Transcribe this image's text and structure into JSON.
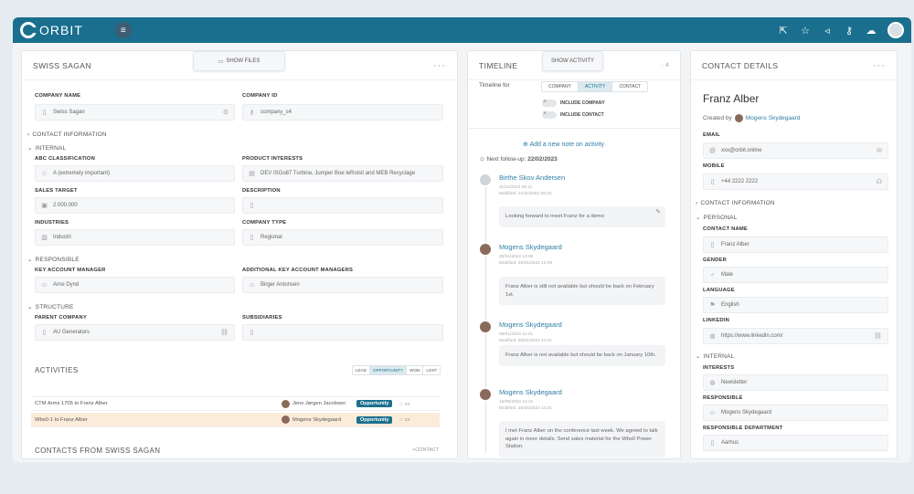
{
  "brand": {
    "name": "ORBIT"
  },
  "colors": {
    "accent": "#1a6f8e",
    "link": "#2f7fa6",
    "highlight_row": "#fbecd9"
  },
  "topbar_icons": [
    "share-icon",
    "star-icon",
    "megaphone-icon",
    "key-icon",
    "cloud-icon",
    "user-avatar"
  ],
  "company": {
    "title": "SWISS SAGAN",
    "show_files": "SHOW FILES",
    "company_name_label": "COMPANY NAME",
    "company_name": "Swiss Sagan",
    "company_id_label": "COMPANY ID",
    "company_id": "company_s4",
    "contact_info_section": "CONTACT INFORMATION",
    "internal_section": "INTERNAL",
    "abc_label": "ABC CLASSIFICATION",
    "abc_value": "A (extremely important)",
    "product_interests_label": "PRODUCT INTERESTS",
    "product_interests_value": "DEV ISGo87 Turbine, Jumper Boe leRoisit and MEB Recyclage",
    "sales_target_label": "SALES TARGET",
    "sales_target_value": "2.000.000",
    "description_label": "DESCRIPTION",
    "industries_label": "INDUSTRIES",
    "industries_value": "Industri",
    "company_type_label": "COMPANY TYPE",
    "company_type_value": "Regional",
    "responsible_section": "RESPONSIBLE",
    "kam_label": "KEY ACCOUNT MANAGER",
    "kam_value": "Arne Dynd",
    "akam_label": "ADDITIONAL KEY ACCOUNT MANAGERS",
    "akam_value": "Birger Antonsen",
    "structure_section": "STRUCTURE",
    "parent_label": "PARENT COMPANY",
    "parent_value": "AU Generators",
    "subsidiaries_label": "SUBSIDIARIES",
    "activities_title": "ACTIVITIES",
    "activity_filters": [
      "LEAD",
      "OPPORTUNITY",
      "WON",
      "LOST"
    ],
    "activities": [
      {
        "title": "CTM Arms 1705 to Franz Alber",
        "person": "Jens Jørgen Jacobsen",
        "status": "Opportunity"
      },
      {
        "title": "Wbs0-1 to Franz Alber",
        "person": "Mogens Skydegaard",
        "status": "Opportunity"
      }
    ],
    "contacts_title": "CONTACTS FROM SWISS SAGAN",
    "contacts_action": "+CONTACT"
  },
  "timeline": {
    "title": "TIMELINE",
    "show_activity": "SHOW ACTIVITY",
    "count": "4",
    "timeline_for": "Timeline for",
    "tabs": [
      "COMPANY",
      "ACTIVITY",
      "CONTACT"
    ],
    "include_company": "INCLUDE COMPANY",
    "include_contact": "INCLUDE CONTACT",
    "add_note": "Add a new note on activity",
    "next_followup_label": "Next follow-up:",
    "next_followup_date": "22/02/2023",
    "entries": [
      {
        "name": "Birthe Skov Andersen",
        "created": "11/11/2022 09:11",
        "modified": "Modified: 11/11/2022 09:22",
        "text": "Looking forward to meet Franz for a demo"
      },
      {
        "name": "Mogens Skydegaard",
        "created": "26/01/2022 13:05",
        "modified": "Modified: 26/01/2022 13:09",
        "text": "Franz Alber is still not available but should be back on February 1st."
      },
      {
        "name": "Mogens Skydegaard",
        "created": "05/01/2022 11:01",
        "modified": "Modified: 05/01/2022 11:01",
        "text": "Franz Alber is not available but should be back on January 10th."
      },
      {
        "name": "Mogens Skydegaard",
        "created": "15/05/2022 14:31",
        "modified": "Modified: 15/05/2022 14:31",
        "text": "I met Franz Alber on the conference last week. We agreed to talk again in more details. Send sales material for the Wbs0 Power Station."
      }
    ]
  },
  "contact": {
    "title": "CONTACT DETAILS",
    "name": "Franz Alber",
    "created_by_label": "Created by",
    "created_by": "Mogens Skydegaard",
    "email_label": "EMAIL",
    "email_value": "xxx@orbit.online",
    "mobile_label": "MOBILE",
    "mobile_value": "+44 2222 2222",
    "contact_info_section": "CONTACT INFORMATION",
    "personal_section": "PERSONAL",
    "contact_name_label": "CONTACT NAME",
    "contact_name_value": "Franz Alber",
    "gender_label": "GENDER",
    "gender_value": "Male",
    "language_label": "LANGUAGE",
    "language_value": "English",
    "linkedin_label": "LINKEDIN",
    "linkedin_value": "https://www.linkedin.com/",
    "internal_section": "INTERNAL",
    "interests_label": "INTERESTS",
    "interests_value": "Newsletter",
    "responsible_label": "RESPONSIBLE",
    "responsible_value": "Mogens Skydegaard",
    "resp_dept_label": "RESPONSIBLE DEPARTMENT",
    "resp_dept_value": "Aarhus"
  }
}
